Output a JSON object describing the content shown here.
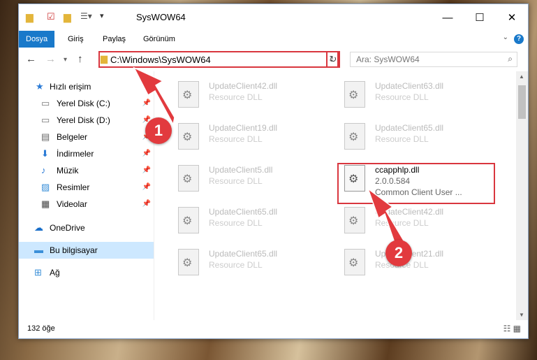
{
  "window": {
    "title": "SysWOW64"
  },
  "ribbon": {
    "tabs": [
      "Dosya",
      "Giriş",
      "Paylaş",
      "Görünüm"
    ],
    "help": "?"
  },
  "navigation": {
    "address": "C:\\Windows\\SysWOW64",
    "search_placeholder": "Ara: SysWOW64"
  },
  "sidebar": {
    "items": [
      {
        "label": "Hızlı erişim",
        "icon": "star-icon",
        "pinned": false
      },
      {
        "label": "Yerel Disk (C:)",
        "icon": "drive-icon",
        "pinned": true
      },
      {
        "label": "Yerel Disk (D:)",
        "icon": "drive-icon",
        "pinned": true
      },
      {
        "label": "Belgeler",
        "icon": "documents-icon",
        "pinned": true
      },
      {
        "label": "İndirmeler",
        "icon": "download-icon",
        "pinned": true
      },
      {
        "label": "Müzik",
        "icon": "music-icon",
        "pinned": true
      },
      {
        "label": "Resimler",
        "icon": "pictures-icon",
        "pinned": true
      },
      {
        "label": "Videolar",
        "icon": "videos-icon",
        "pinned": true
      },
      {
        "label": "OneDrive",
        "icon": "cloud-icon",
        "pinned": false
      },
      {
        "label": "Bu bilgisayar",
        "icon": "computer-icon",
        "pinned": false
      },
      {
        "label": "Ağ",
        "icon": "network-icon",
        "pinned": false
      }
    ]
  },
  "files": [
    {
      "name": "UpdateClient42.dll",
      "desc": "Resource DLL"
    },
    {
      "name": "UpdateClient63.dll",
      "desc": "Resource DLL"
    },
    {
      "name": "UpdateClient19.dll",
      "desc": "Resource DLL"
    },
    {
      "name": "UpdateClient65.dll",
      "desc": "Resource DLL"
    },
    {
      "name": "UpdateClient5.dll",
      "desc": "Resource DLL"
    },
    {
      "name": "ccapphlp.dll",
      "desc": "2.0.0.584",
      "desc2": "Common Client User ..."
    },
    {
      "name": "UpdateClient65.dll",
      "desc": "Resource DLL"
    },
    {
      "name": "UpdateClient42.dll",
      "desc": "Resource DLL"
    },
    {
      "name": "UpdateClient65.dll",
      "desc": "Resource DLL"
    },
    {
      "name": "UpdateClient21.dll",
      "desc": "Resource DLL"
    }
  ],
  "status": {
    "count": "132 öğe"
  },
  "annotations": {
    "step1": "1",
    "step2": "2"
  },
  "colors": {
    "accent": "#1979ca",
    "highlight": "#d9363e"
  }
}
